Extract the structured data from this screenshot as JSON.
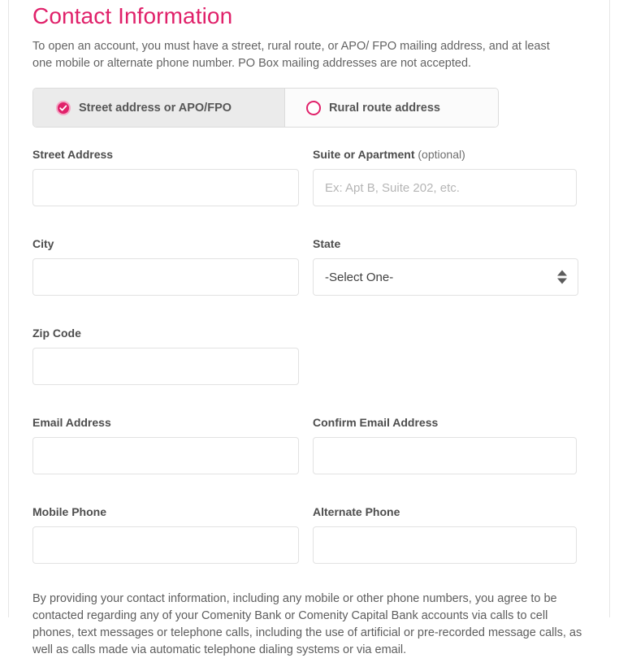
{
  "page": {
    "title": "Contact Information",
    "intro": "To open an account, you must have a street, rural route, or APO/ FPO mailing address, and at least one mobile or alternate phone number. PO Box mailing addresses are not accepted.",
    "disclosure": "By providing your contact information, including any mobile or other phone numbers, you agree to be contacted regarding any of your Comenity Bank or Comenity Capital Bank accounts via calls to cell phones, text messages or telephone calls, including the use of artificial or pre-recorded message calls, as well as calls made via automatic telephone dialing systems or via email."
  },
  "colors": {
    "brand_pink": "#e0216a",
    "label_gray": "#4d4d4d",
    "body_gray": "#5d5d5d",
    "tab_selected_bg": "#ebebeb",
    "border_gray": "#e2e2e2"
  },
  "address_type": {
    "options": [
      {
        "label": "Street address or APO/FPO",
        "selected": true,
        "icon": "radio-checked-icon"
      },
      {
        "label": "Rural route address",
        "selected": false,
        "icon": "radio-unchecked-icon"
      }
    ]
  },
  "fields": {
    "street_address": {
      "label": "Street Address",
      "value": "",
      "placeholder": ""
    },
    "suite": {
      "label": "Suite or Apartment",
      "label_optional": "(optional)",
      "value": "",
      "placeholder": "Ex: Apt B, Suite 202, etc."
    },
    "city": {
      "label": "City",
      "value": "",
      "placeholder": ""
    },
    "state": {
      "label": "State",
      "value": "-Select One-",
      "icon": "select-arrows-icon"
    },
    "zip_code": {
      "label": "Zip Code",
      "value": "",
      "placeholder": ""
    },
    "email": {
      "label": "Email Address",
      "value": "",
      "placeholder": ""
    },
    "confirm_email": {
      "label": "Confirm Email Address",
      "value": "",
      "placeholder": ""
    },
    "mobile_phone": {
      "label": "Mobile Phone",
      "value": "",
      "placeholder": ""
    },
    "alternate_phone": {
      "label": "Alternate Phone",
      "value": "",
      "placeholder": ""
    }
  }
}
